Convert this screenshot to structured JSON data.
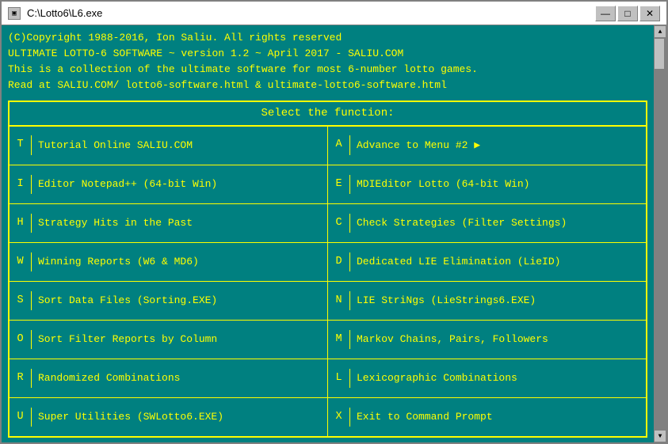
{
  "window": {
    "title": "C:\\Lotto6\\L6.exe",
    "icon_label": "▣"
  },
  "titlebar_buttons": {
    "minimize": "—",
    "maximize": "□",
    "close": "✕"
  },
  "header": {
    "line1": "(C)Copyright 1988-2016, Ion Saliu. All rights reserved",
    "line2": "ULTIMATE LOTTO-6 SOFTWARE ~ version 1.2 ~ April 2017 - SALIU.COM",
    "line3": "This is a collection of the ultimate software for most 6-number lotto games.",
    "line4": "Read at SALIU.COM/ lotto6-software.html & ultimate-lotto6-software.html"
  },
  "menu": {
    "title": "Select the function:",
    "rows": [
      {
        "left_key": "T",
        "left_label": "Tutorial Online SALIU.COM",
        "right_key": "A",
        "right_label": "Advance to Menu #2",
        "right_arrow": true
      },
      {
        "left_key": "I",
        "left_label": "Editor Notepad++ (64-bit Win)",
        "right_key": "E",
        "right_label": "MDIEditor Lotto (64-bit Win)",
        "right_arrow": false
      },
      {
        "left_key": "H",
        "left_label": "Strategy Hits in the Past",
        "right_key": "C",
        "right_label": "Check Strategies (Filter Settings)",
        "right_arrow": false
      },
      {
        "left_key": "W",
        "left_label": "Winning Reports (W6 & MD6)",
        "right_key": "D",
        "right_label": "Dedicated LIE Elimination (LieID)",
        "right_arrow": false
      },
      {
        "left_key": "S",
        "left_label": "Sort Data Files (Sorting.EXE)",
        "right_key": "N",
        "right_label": "LIE StriNgs (LieStrings6.EXE)",
        "right_arrow": false
      },
      {
        "left_key": "O",
        "left_label": "Sort Filter Reports by Column",
        "right_key": "M",
        "right_label": "Markov Chains, Pairs, Followers",
        "right_arrow": false
      },
      {
        "left_key": "R",
        "left_label": "Randomized Combinations",
        "right_key": "L",
        "right_label": "Lexicographic Combinations",
        "right_arrow": false
      },
      {
        "left_key": "U",
        "left_label": "Super Utilities (SWLotto6.EXE)",
        "right_key": "X",
        "right_label": "Exit to Command Prompt",
        "right_arrow": false
      }
    ]
  }
}
